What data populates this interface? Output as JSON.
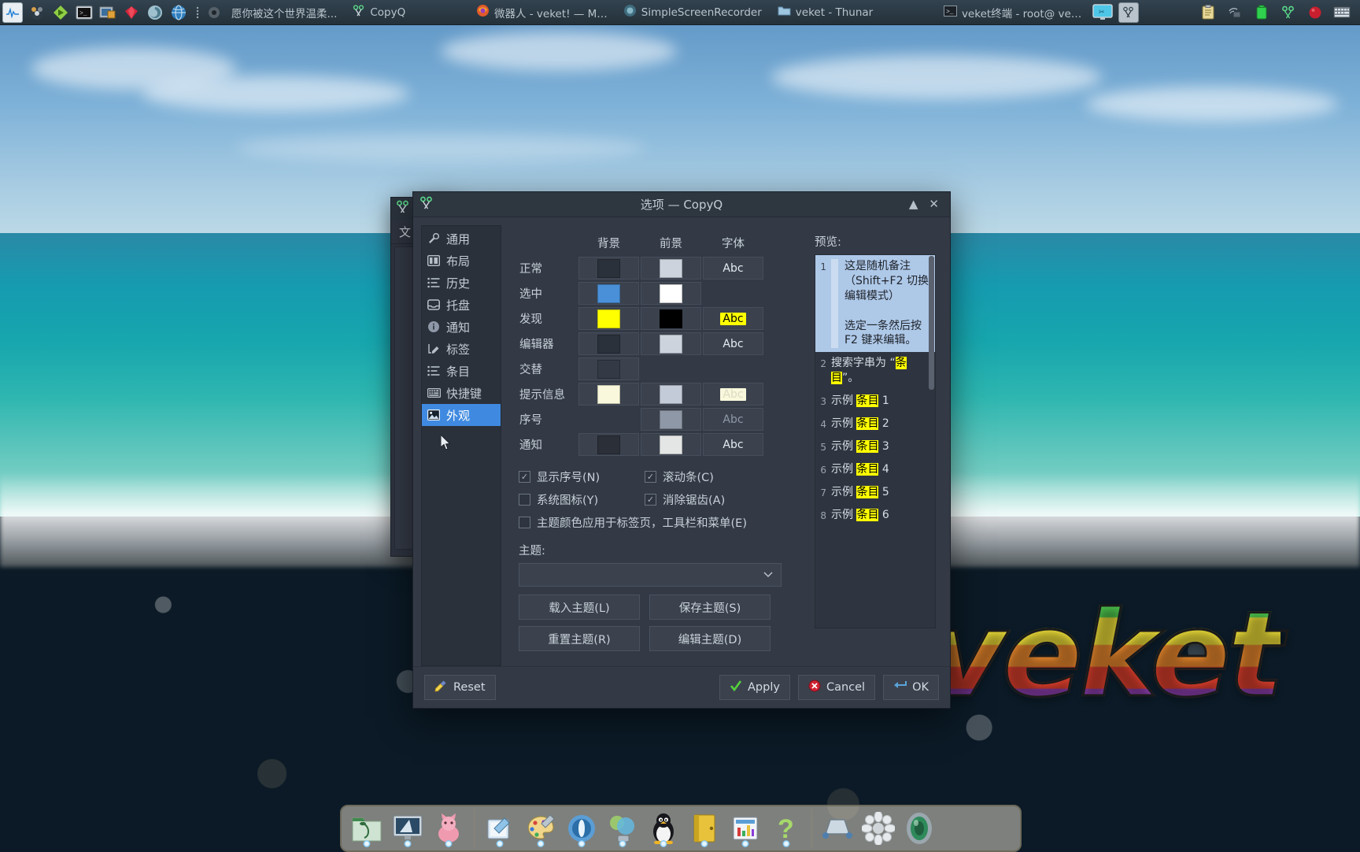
{
  "top_panel": {
    "launcher_icons": [
      "system-monitor-icon",
      "media-player-icon",
      "terminal-green-icon",
      "terminal-icon",
      "screenshot-icon",
      "ruby-gem-icon",
      "spiral-icon",
      "globe-icon"
    ],
    "menu_icons": [
      "list-menu-icon",
      "power-icon"
    ],
    "tasks": [
      {
        "icon": "scissors-icon",
        "label": "愿你被这个世界温柔..."
      },
      {
        "icon": "scissors-icon",
        "label": "CopyQ"
      },
      {
        "icon": "firefox-icon",
        "label": "微器人 - veket! — M…"
      },
      {
        "icon": "recorder-icon",
        "label": "SimpleScreenRecorder"
      },
      {
        "icon": "folder-icon",
        "label": "veket - Thunar"
      },
      {
        "icon": "terminal-icon",
        "label": "veket终端 - root@ ve…"
      }
    ],
    "extra_icons": [
      "display-icon",
      "scissors-icon"
    ],
    "tray_icons": [
      "clipboard-icon",
      "network-icon",
      "battery-icon",
      "scissors-icon",
      "record-icon",
      "keyboard-icon"
    ]
  },
  "background_window": {
    "title_icon": "scissors-icon",
    "menu_label": "文"
  },
  "dialog": {
    "title": "选项 — CopyQ",
    "title_icon": "scissors-icon",
    "buttons": {
      "shade": "▲",
      "close": "✕"
    },
    "sidebar": [
      {
        "icon": "wrench-icon",
        "label": "通用",
        "selected": false
      },
      {
        "icon": "layout-icon",
        "label": "布局",
        "selected": false
      },
      {
        "icon": "history-icon",
        "label": "历史",
        "selected": false
      },
      {
        "icon": "tray-icon",
        "label": "托盘",
        "selected": false
      },
      {
        "icon": "info-icon",
        "label": "通知",
        "selected": false
      },
      {
        "icon": "tag-icon",
        "label": "标签",
        "selected": false
      },
      {
        "icon": "items-icon",
        "label": "条目",
        "selected": false
      },
      {
        "icon": "keyboard-icon",
        "label": "快捷键",
        "selected": false
      },
      {
        "icon": "appearance-icon",
        "label": "外观",
        "selected": true
      }
    ],
    "appearance": {
      "columns": {
        "background": "背景",
        "foreground": "前景",
        "font": "字体"
      },
      "font_sample": "Abc",
      "rows": [
        {
          "label": "正常",
          "bg": "#2b313b",
          "fg": "#ccd3dd",
          "font": true,
          "font_bg": "#3b424e",
          "font_fg": "#e6ebf1"
        },
        {
          "label": "选中",
          "bg": "#4a90d9",
          "fg": "#ffffff",
          "font": false,
          "font_bg": "",
          "font_fg": ""
        },
        {
          "label": "发现",
          "bg": "#ffff00",
          "fg": "#000000",
          "font": true,
          "font_bg": "#ffff00",
          "font_fg": "#000000"
        },
        {
          "label": "编辑器",
          "bg": "#2b313b",
          "fg": "#ccd3dd",
          "font": true,
          "font_bg": "#3b424e",
          "font_fg": "#e6ebf1"
        },
        {
          "label": "交替",
          "bg": "#333a45",
          "fg": "",
          "font": false,
          "font_bg": "",
          "font_fg": ""
        },
        {
          "label": "提示信息",
          "bg": "#f9f8dc",
          "fg": "#c3cbd8",
          "font": true,
          "font_bg": "#f9f8dc",
          "font_fg": "#d9dbc6"
        },
        {
          "label": "序号",
          "bg": "",
          "fg": "#8f98a6",
          "font": true,
          "font_bg": "#3b424e",
          "font_fg": "#8f98a6"
        },
        {
          "label": "通知",
          "bg": "#2a2f38",
          "fg": "#e4e6e6",
          "font": true,
          "font_bg": "#3b424e",
          "font_fg": "#e6ebf1"
        }
      ],
      "checkboxes": [
        {
          "label": "显示序号(N)",
          "mnemonic": "N",
          "checked": true
        },
        {
          "label": "滚动条(C)",
          "mnemonic": "C",
          "checked": true
        },
        {
          "label": "系统图标(Y)",
          "mnemonic": "Y",
          "checked": false
        },
        {
          "label": "消除锯齿(A)",
          "mnemonic": "A",
          "checked": true
        },
        {
          "label": "主题颜色应用于标签页，工具栏和菜单(E)",
          "mnemonic": "E",
          "checked": false
        }
      ],
      "theme_label": "主题:",
      "theme_value": "",
      "theme_placeholder": "",
      "theme_buttons": [
        {
          "label": "载入主题(L)",
          "mnemonic": "L"
        },
        {
          "label": "保存主题(S)",
          "mnemonic": "S"
        },
        {
          "label": "重置主题(R)",
          "mnemonic": "R"
        },
        {
          "label": "编辑主题(D)",
          "mnemonic": "D"
        }
      ]
    },
    "preview": {
      "label": "预览:",
      "items": [
        {
          "num": "1",
          "selected": true,
          "text": "这是随机备注（Shift+F2 切换编辑模式）\n\n选定一条然后按 F2 键来编辑。"
        },
        {
          "num": "2",
          "selected": false,
          "pre": "搜索字串为 “",
          "hl": "条目",
          "post": "”。"
        },
        {
          "num": "3",
          "selected": false,
          "pre": "示例 ",
          "hl": "条目",
          "post": " 1"
        },
        {
          "num": "4",
          "selected": false,
          "pre": "示例 ",
          "hl": "条目",
          "post": " 2"
        },
        {
          "num": "5",
          "selected": false,
          "pre": "示例 ",
          "hl": "条目",
          "post": " 3"
        },
        {
          "num": "6",
          "selected": false,
          "pre": "示例 ",
          "hl": "条目",
          "post": " 4"
        },
        {
          "num": "7",
          "selected": false,
          "pre": "示例 ",
          "hl": "条目",
          "post": " 5"
        },
        {
          "num": "8",
          "selected": false,
          "pre": "示例 ",
          "hl": "条目",
          "post": " 6"
        }
      ]
    },
    "footer": {
      "reset": "Reset",
      "apply": "Apply",
      "cancel": "Cancel",
      "ok": "OK"
    }
  },
  "desktop": {
    "wordmark": "veket"
  },
  "dock": {
    "group1": [
      "file-manager-icon",
      "desktop-settings-icon",
      "pink-cat-icon"
    ],
    "group2": [
      "notepad-icon",
      "paint-palette-icon",
      "eye-blue-icon",
      "browser-bubbles-icon",
      "tux-penguin-icon",
      "yellow-book-icon",
      "spreadsheet-icon",
      "help-question-icon"
    ],
    "group3": [
      "network-shape-icon",
      "sun-flower-icon",
      "camera-globe-icon"
    ]
  },
  "colors": {
    "accent": "#3f8ae0",
    "dialog_bg": "#333a46",
    "panel_bg": "#2b313b",
    "highlight_yellow": "#ffff00",
    "preview_selected": "#aec8e8"
  }
}
